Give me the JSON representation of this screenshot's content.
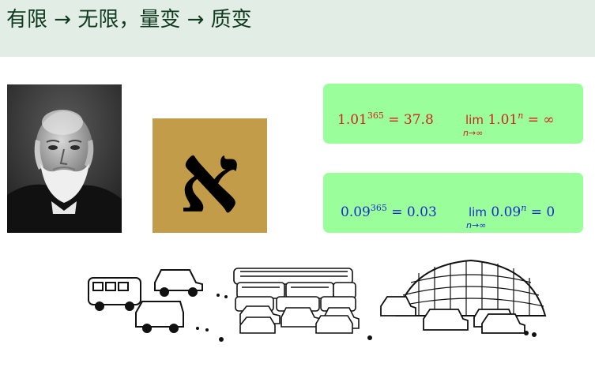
{
  "slide": {
    "title": "有限 → 无限，量变 → 质变"
  },
  "aleph": {
    "glyph": "א",
    "background": "#c39c4a"
  },
  "formulas": {
    "box1": {
      "left_base": "1.01",
      "left_exp": "365",
      "left_result": " = 37.8",
      "lim_label": "lim",
      "lim_sub": "n→∞",
      "right_base": " 1.01",
      "right_exp": "n",
      "right_result": " = ∞",
      "color": "#d42020"
    },
    "box2": {
      "left_base": "0.09",
      "left_exp": "365",
      "left_result": " = 0.03",
      "lim_label": "lim",
      "lim_sub": "n→∞",
      "right_base": " 0.09",
      "right_exp": "n",
      "right_result": " = 0",
      "color": "#1a2ad0"
    },
    "box_color": "#9aff9a"
  },
  "colors": {
    "header_bg": "#e2ede6",
    "title_text": "#103a1d"
  }
}
